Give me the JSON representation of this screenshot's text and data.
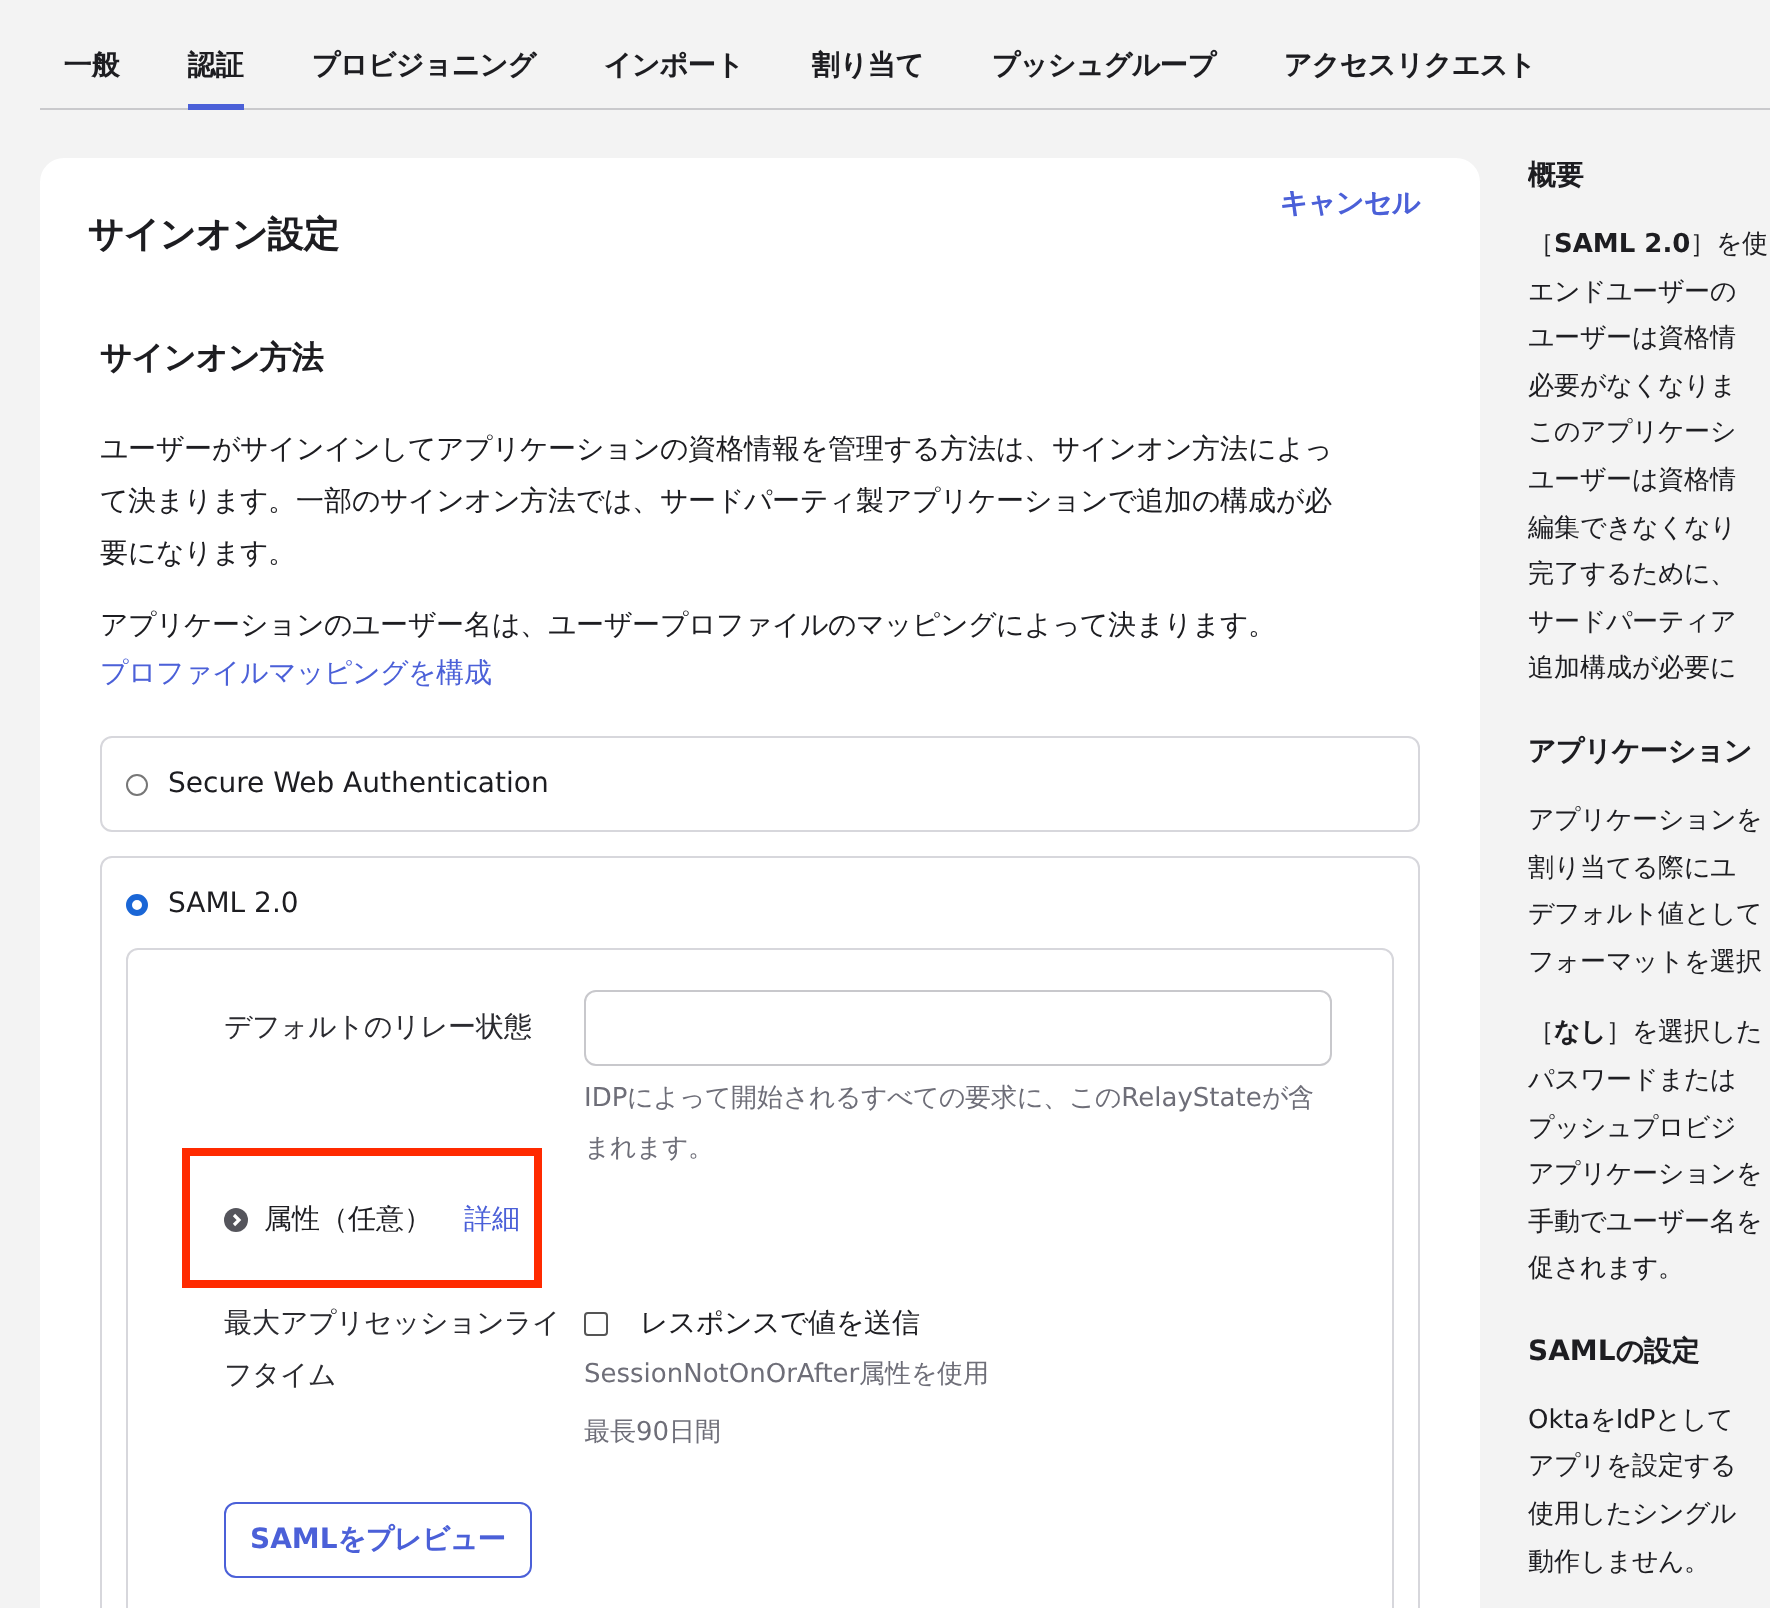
{
  "tabs": [
    {
      "label": "一般",
      "selected": false
    },
    {
      "label": "認証",
      "selected": true
    },
    {
      "label": "プロビジョニング",
      "selected": false
    },
    {
      "label": "インポート",
      "selected": false
    },
    {
      "label": "割り当て",
      "selected": false
    },
    {
      "label": "プッシュグループ",
      "selected": false
    },
    {
      "label": "アクセスリクエスト",
      "selected": false
    }
  ],
  "card": {
    "title": "サインオン設定",
    "cancel_link": "キャンセル",
    "section_title": "サインオン方法",
    "description": "ユーザーがサインインしてアプリケーションの資格情報を管理する方法は、サインオン方法によって決まります。一部のサインオン方法では、サードパーティ製アプリケーションで追加の構成が必要になります。",
    "username_note": "アプリケーションのユーザー名は、ユーザープロファイルのマッピングによって決まります。",
    "mapping_link": "プロファイルマッピングを構成",
    "methods": [
      {
        "label": "Secure Web Authentication",
        "selected": false
      },
      {
        "label": "SAML 2.0",
        "selected": true
      }
    ],
    "saml": {
      "relay_state": {
        "label": "デフォルトのリレー状態",
        "help": "IDPによって開始されるすべての要求に、このRelayStateが含まれます。"
      },
      "attributes": {
        "label": "属性（任意）",
        "link": "詳細",
        "expanded": false,
        "highlighted": true
      },
      "session_lifetime": {
        "label": "最大アプリセッションライフタイム",
        "checkbox_label": "レスポンスで値を送信",
        "checked": false,
        "hint": "SessionNotOnOrAfter属性を使用",
        "max_note": "最長90日間"
      },
      "preview_button": "SAMLをプレビュー"
    }
  },
  "sidebar": {
    "sections": [
      {
        "title": "概要",
        "paragraphs": [
          [
            "［**SAML 2.0**］を使",
            "エンドユーザーの",
            "ユーザーは資格情",
            "必要がなくなりま",
            "このアプリケーシ",
            "ユーザーは資格情",
            "編集できなくなり",
            "完了するために、",
            "サードパーティア",
            "追加構成が必要に"
          ]
        ]
      },
      {
        "title": "アプリケーション",
        "paragraphs": [
          [
            "アプリケーションを",
            "割り当てる際にユ",
            "デフォルト値として",
            "フォーマットを選択"
          ],
          [
            "［**なし**］を選択した",
            "パスワードまたは",
            "プッシュプロビジ",
            "アプリケーションを",
            "手動でユーザー名を",
            "促されます。"
          ]
        ]
      },
      {
        "title": "SAMLの設定",
        "paragraphs": [
          [
            "OktaをIdPとして",
            "アプリを設定する",
            "使用したシングル",
            "動作しません。"
          ]
        ]
      }
    ]
  }
}
